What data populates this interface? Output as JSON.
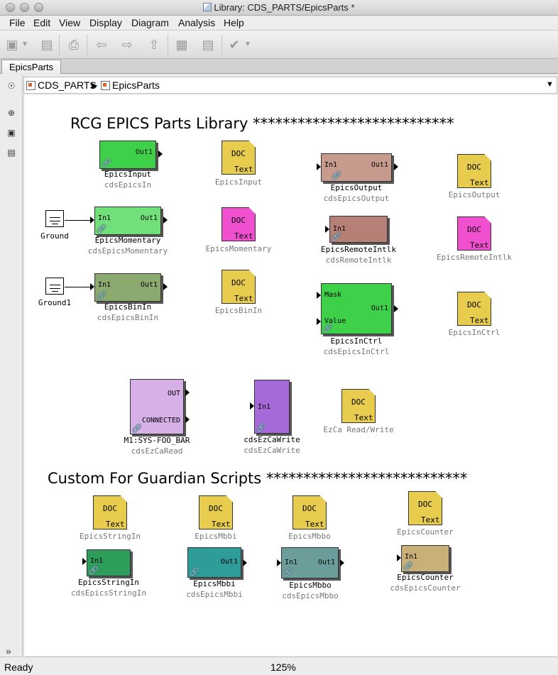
{
  "window": {
    "title": "Library: CDS_PARTS/EpicsParts *"
  },
  "menu": [
    "File",
    "Edit",
    "View",
    "Display",
    "Diagram",
    "Analysis",
    "Help"
  ],
  "tab": {
    "label": "EpicsParts"
  },
  "breadcrumb": {
    "root": "CDS_PARTS",
    "current": "EpicsParts"
  },
  "headers": {
    "library": "RCG EPICS Parts Library ***************************",
    "guardian": "Custom For Guardian Scripts ***************************"
  },
  "doc": {
    "top": "DOC",
    "bottom": "Text"
  },
  "ports": {
    "in1": "In1",
    "out1": "Out1",
    "mask": "Mask",
    "value": "Value",
    "out": "OUT",
    "connected": "CONNECTED"
  },
  "blocks": {
    "epicsInput": {
      "name": "EpicsInput",
      "sub": "cdsEpicsIn",
      "color": "#3fd04a"
    },
    "epicsOutput": {
      "name": "EpicsOutput",
      "sub": "cdsEpicsOutput",
      "color": "#c79a8e"
    },
    "epicsMomentary": {
      "name": "EpicsMomentary",
      "sub": "cdsEpicsMomentary",
      "color": "#72e07a"
    },
    "epicsRemoteIntlk": {
      "name": "EpicsRemoteIntlk",
      "sub": "cdsRemoteIntlk",
      "color": "#b78076"
    },
    "epicsBinIn": {
      "name": "EpicsBinIn",
      "sub": "cdsEpicsBinIn",
      "color": "#8caa6f"
    },
    "epicsInCtrl": {
      "name": "EpicsInCtrl",
      "sub": "cdsEpicsInCtrl",
      "color": "#3fd04a"
    },
    "ezCaRead": {
      "name": "M1:SYS-FOO_BAR",
      "sub": "cdsEzCaRead",
      "color": "#d8b0e8"
    },
    "ezCaWrite": {
      "name": "cdsEzCaWrite",
      "sub": "cdsEzCaWrite",
      "color": "#a66ad8"
    },
    "epicsStringIn": {
      "name": "EpicsStringIn",
      "sub": "cdsEpicsStringIn",
      "color": "#2e9d5c"
    },
    "epicsMbbi": {
      "name": "EpicsMbbi",
      "sub": "cdsEpicsMbbi",
      "color": "#2e9d9a"
    },
    "epicsMbbo": {
      "name": "EpicsMbbo",
      "sub": "cdsEpicsMbbo",
      "color": "#6b9e9a"
    },
    "epicsCounter": {
      "name": "EpicsCounter",
      "sub": "cdsEpicsCounter",
      "color": "#c8b078"
    }
  },
  "docs": {
    "epicsInput": "EpicsInput",
    "epicsOutput": "EpicsOutput",
    "epicsMomentary": "EpicsMomentary",
    "epicsRemoteIntlk": "EpicsRemoteIntlk",
    "epicsBinIn": "EpicsBinIn",
    "epicsInCtrl": "EpicsInCtrl",
    "ezCa": "EzCa Read/Write",
    "epicsStringIn": "EpicsStringIn",
    "epicsMbbi": "EpicsMbbi",
    "epicsMbbo": "EpicsMbbo",
    "epicsCounter": "EpicsCounter"
  },
  "grounds": {
    "g0": "Ground",
    "g1": "Ground1"
  },
  "colors": {
    "docYellow": "#e8cc4e",
    "docMagenta": "#f04fd0"
  },
  "status": {
    "text": "Ready",
    "zoom": "125%"
  }
}
